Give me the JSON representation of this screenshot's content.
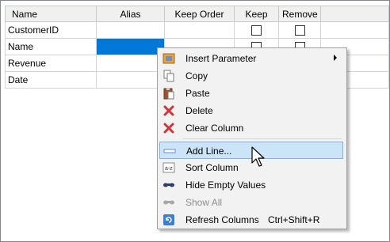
{
  "grid": {
    "columns": [
      "Name",
      "Alias",
      "Keep Order",
      "Keep",
      "Remove"
    ],
    "rows": [
      {
        "name": "CustomerID"
      },
      {
        "name": "Name"
      },
      {
        "name": "Revenue"
      },
      {
        "name": "Date"
      }
    ]
  },
  "context_menu": {
    "items": [
      {
        "label": "Insert Parameter",
        "icon": "insert-parameter-icon",
        "has_submenu": true
      },
      {
        "label": "Copy",
        "icon": "copy-icon"
      },
      {
        "label": "Paste",
        "icon": "paste-icon"
      },
      {
        "label": "Delete",
        "icon": "delete-icon",
        "color": "#d13438"
      },
      {
        "label": "Clear Column",
        "icon": "clear-column-icon",
        "color": "#d13438"
      },
      {
        "label": "Add Line...",
        "icon": "add-line-icon",
        "highlighted": true
      },
      {
        "label": "Sort Column",
        "icon": "sort-column-icon"
      },
      {
        "label": "Hide Empty Values",
        "icon": "hide-empty-values-icon"
      },
      {
        "label": "Show All",
        "icon": "show-all-icon",
        "disabled": true
      },
      {
        "label": "Refresh Columns",
        "icon": "refresh-columns-icon",
        "shortcut": "Ctrl+Shift+R"
      }
    ]
  },
  "colors": {
    "selection": "#0078d7",
    "menu_highlight": "#cce4f7",
    "menu_highlight_border": "#7eb4ea",
    "menu_background": "#f2f2f2"
  }
}
